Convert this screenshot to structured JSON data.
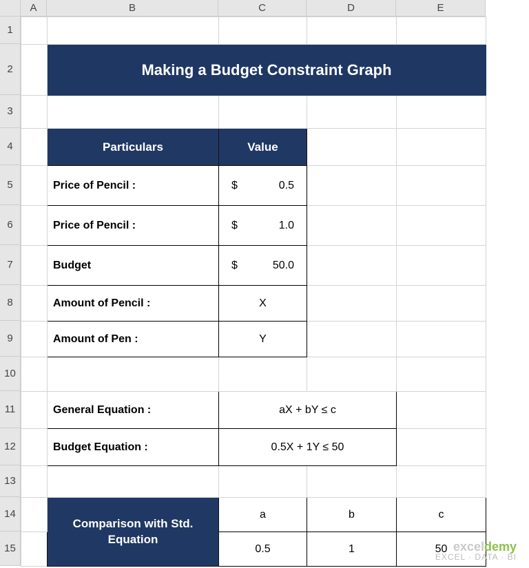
{
  "columns": [
    "A",
    "B",
    "C",
    "D",
    "E"
  ],
  "rows": [
    "1",
    "2",
    "3",
    "4",
    "5",
    "6",
    "7",
    "8",
    "9",
    "10",
    "11",
    "12",
    "13",
    "14",
    "15"
  ],
  "title": "Making a Budget Constraint Graph",
  "table1": {
    "header": {
      "particulars": "Particulars",
      "value": "Value"
    },
    "rows": [
      {
        "label": "Price of Pencil :",
        "currency": "$",
        "value": "0.5"
      },
      {
        "label": "Price of Pencil :",
        "currency": "$",
        "value": "1.0"
      },
      {
        "label": "Budget",
        "currency": "$",
        "value": "50.0"
      },
      {
        "label": "Amount of Pencil :",
        "value": "X"
      },
      {
        "label": "Amount of Pen :",
        "value": "Y"
      }
    ]
  },
  "equations": {
    "general_label": "General Equation :",
    "general_value": "aX + bY ≤ c",
    "budget_label": "Budget Equation :",
    "budget_value": "0.5X + 1Y ≤ 50"
  },
  "comparison": {
    "header": "Comparison with Std. Equation",
    "cols": [
      "a",
      "b",
      "c"
    ],
    "vals": [
      "0.5",
      "1",
      "50"
    ]
  },
  "watermark": {
    "line1a": "excel",
    "line1b": "demy",
    "line2": "EXCEL · DATA · BI"
  }
}
